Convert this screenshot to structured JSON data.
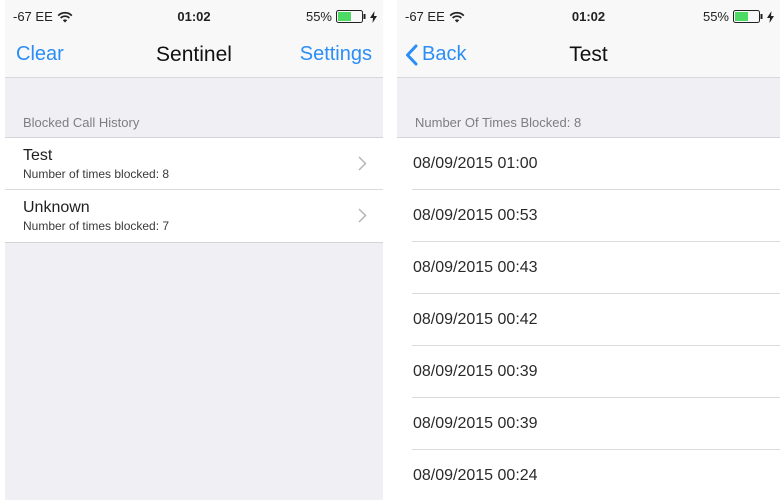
{
  "left": {
    "status": {
      "carrier": "-67 EE",
      "time": "01:02",
      "battery": "55%"
    },
    "nav": {
      "left_button": "Clear",
      "title": "Sentinel",
      "right_button": "Settings"
    },
    "section_header": "Blocked Call History",
    "rows": [
      {
        "title": "Test",
        "subtitle": "Number of times blocked: 8"
      },
      {
        "title": "Unknown",
        "subtitle": "Number of times blocked: 7"
      }
    ]
  },
  "right": {
    "status": {
      "carrier": "-67 EE",
      "time": "01:02",
      "battery": "55%"
    },
    "nav": {
      "back_button": "Back",
      "title": "Test"
    },
    "section_header": "Number Of Times Blocked: 8",
    "rows": [
      "08/09/2015 01:00",
      "08/09/2015 00:53",
      "08/09/2015 00:43",
      "08/09/2015 00:42",
      "08/09/2015 00:39",
      "08/09/2015 00:39",
      "08/09/2015 00:24"
    ]
  },
  "colors": {
    "accent": "#2b8ef5",
    "battery": "#4cd964",
    "background": "#efeff4"
  },
  "icons": [
    "wifi-icon",
    "battery-icon",
    "charging-bolt-icon",
    "chevron-right-icon",
    "back-chevron-icon"
  ]
}
